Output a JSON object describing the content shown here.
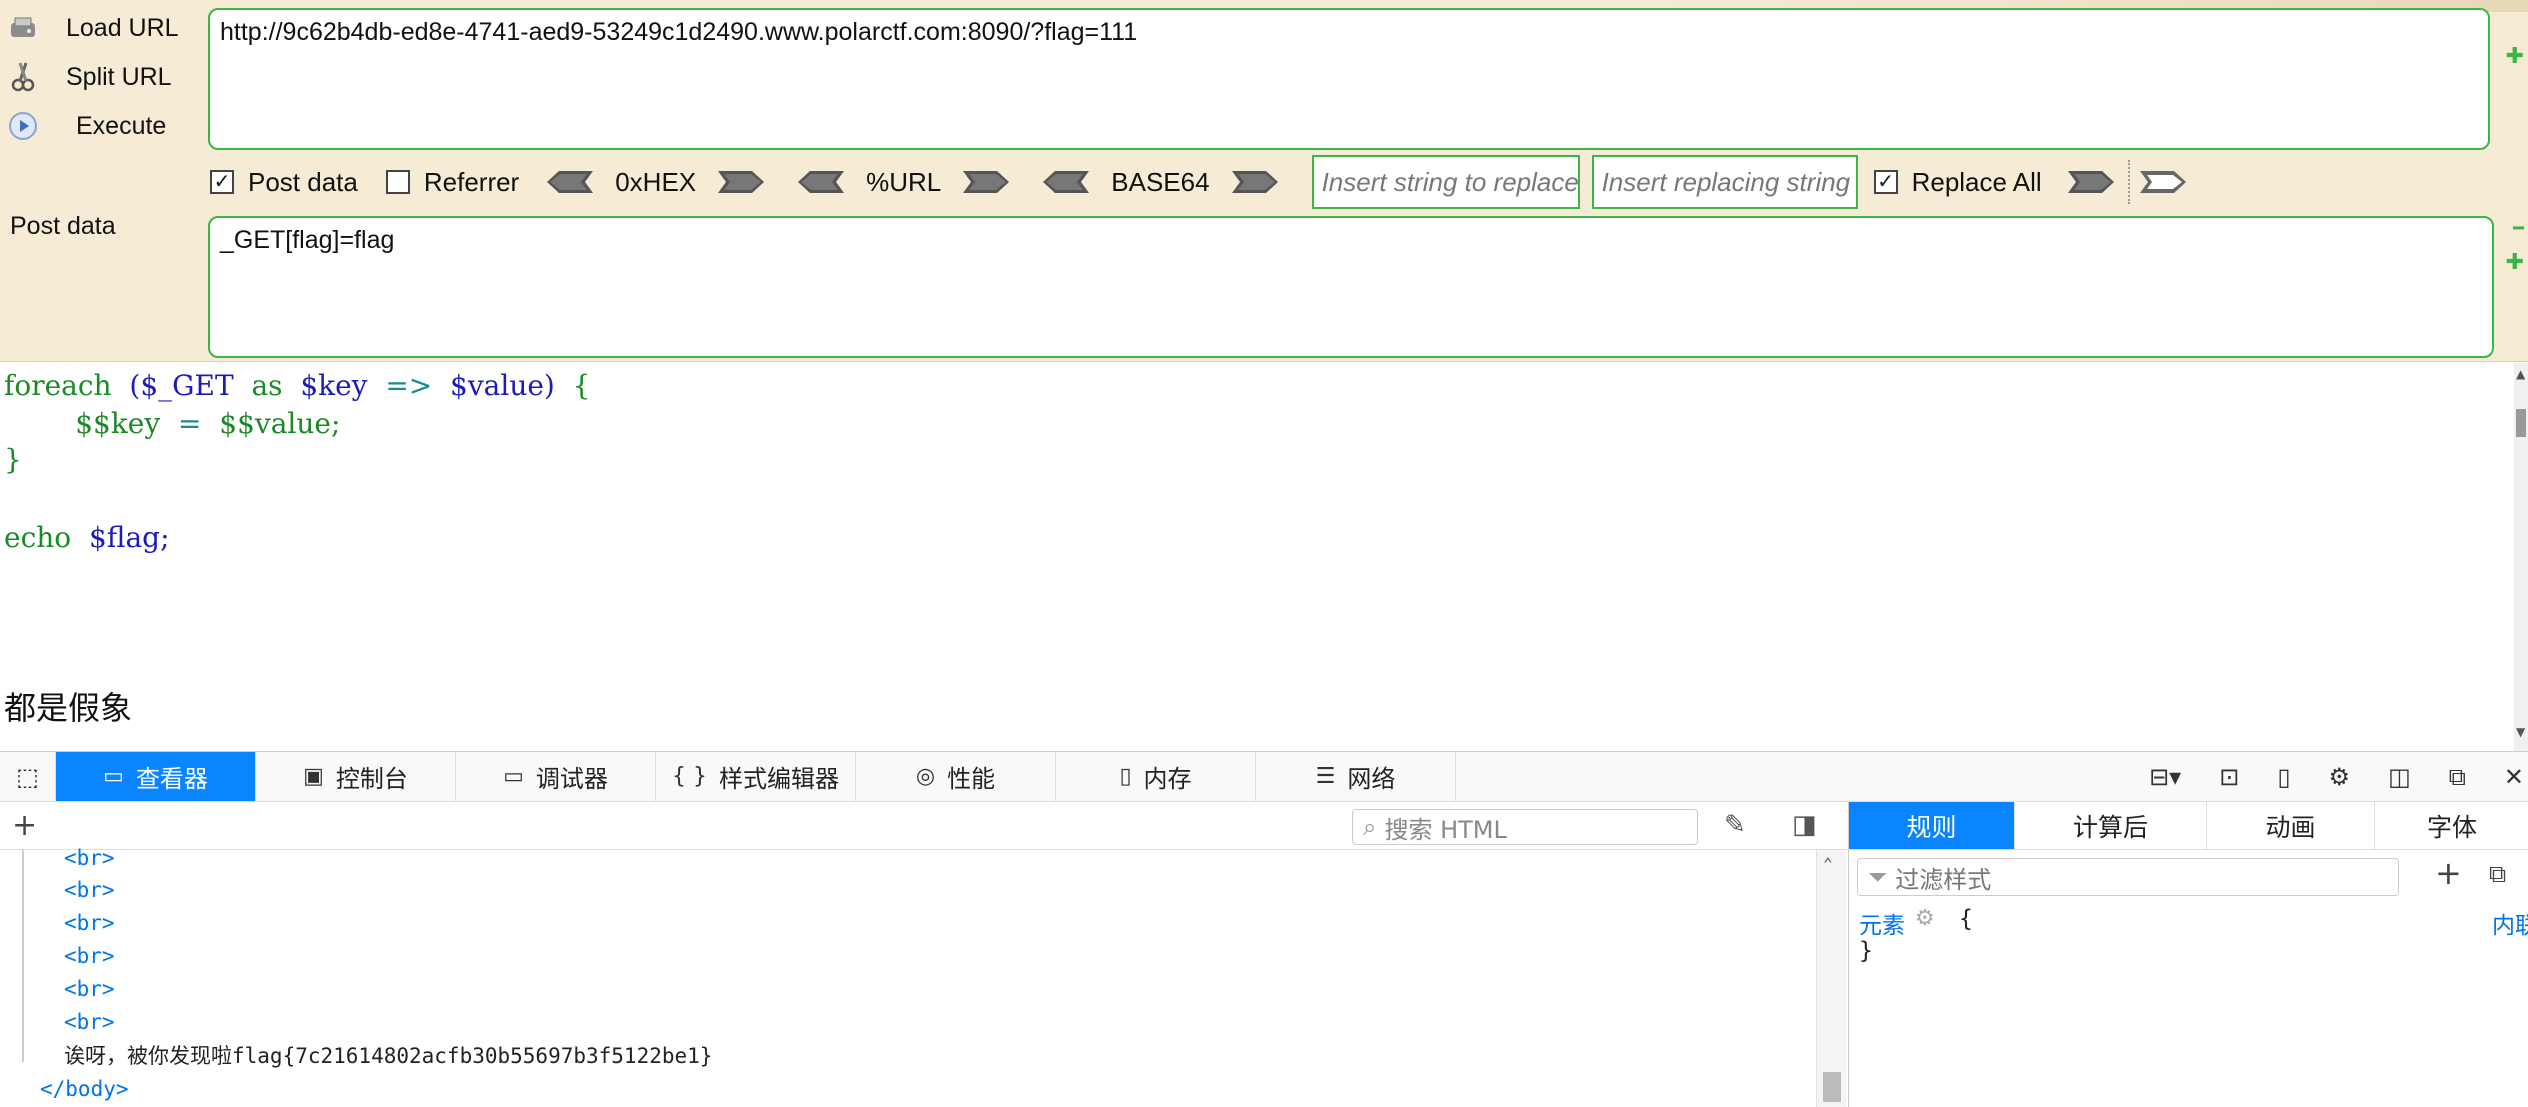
{
  "hackbar": {
    "load_url_label": "Load URL",
    "split_url_label": "Split URL",
    "execute_label": "Execute",
    "url_value": "http://9c62b4db-ed8e-4741-aed9-53249c1d2490.www.polarctf.com:8090/?flag=111",
    "post_data_checkbox_label": "Post data",
    "post_data_checked": true,
    "referrer_label": "Referrer",
    "referrer_checked": false,
    "hex_label": "0xHEX",
    "url_enc_label": "%URL",
    "base64_label": "BASE64",
    "replace_from_placeholder": "Insert string to replace",
    "replace_to_placeholder": "Insert replacing string",
    "replace_all_label": "Replace All",
    "replace_all_checked": true,
    "post_data_section_label": "Post data",
    "post_data_value": "_GET[flag]=flag"
  },
  "page": {
    "code_line1": [
      "foreach",
      "($_GET",
      "as",
      "$key",
      "=>",
      "$value)",
      "{"
    ],
    "code_line2": [
      "$$key",
      "=",
      "$$value;"
    ],
    "code_line3": "}",
    "code_line4": [
      "echo",
      "$flag;"
    ],
    "heading": "都是假象"
  },
  "devtools": {
    "tabs": [
      {
        "label": "查看器",
        "icon": "inspector-icon"
      },
      {
        "label": "控制台",
        "icon": "console-icon"
      },
      {
        "label": "调试器",
        "icon": "debugger-icon"
      },
      {
        "label": "样式编辑器",
        "icon": "style-editor-icon"
      },
      {
        "label": "性能",
        "icon": "performance-icon"
      },
      {
        "label": "内存",
        "icon": "memory-icon"
      },
      {
        "label": "网络",
        "icon": "network-icon"
      }
    ],
    "search_placeholder": "搜索 HTML",
    "tree": {
      "br": "<br>",
      "flag_text": "诶呀，被你发现啦flag{7c21614802acfb30b55697b3f5122be1}",
      "body_close": "</body>"
    },
    "right_tabs": [
      "规则",
      "计算后",
      "动画",
      "字体"
    ],
    "filter_placeholder": "过滤样式",
    "element_label": "元素",
    "brace_open": "{",
    "brace_close": "}",
    "inline_label": "内联"
  },
  "colors": {
    "hackbar_bg": "#f6ecd6",
    "green_border": "#3db445",
    "active_tab": "#0a84ff"
  }
}
